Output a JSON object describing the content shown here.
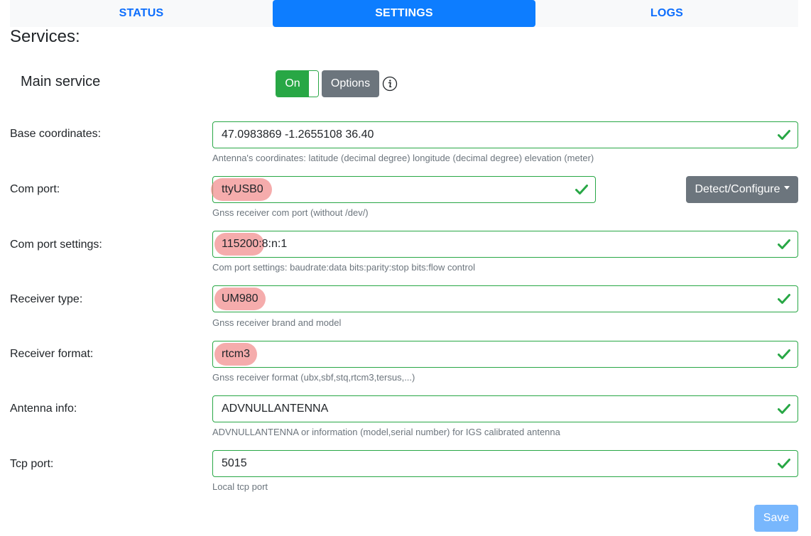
{
  "tabs": [
    {
      "label": "STATUS",
      "active": false
    },
    {
      "label": "SETTINGS",
      "active": true
    },
    {
      "label": "LOGS",
      "active": false
    }
  ],
  "section_title": "Services:",
  "main_service": {
    "label": "Main service",
    "toggle_label": "On",
    "toggle_state": true,
    "options_label": "Options",
    "info_icon": "info-circle-icon"
  },
  "fields": {
    "base_coordinates": {
      "label": "Base coordinates:",
      "value": "47.0983869 -1.2655108 36.40",
      "help": "Antenna's coordinates: latitude (decimal degree) longitude (decimal degree) elevation (meter)"
    },
    "com_port": {
      "label": "Com port:",
      "value": "ttyUSB0",
      "help": "Gnss receiver com port (without /dev/)"
    },
    "com_port_settings": {
      "label": "Com port settings:",
      "value": "115200:8:n:1",
      "help": "Com port settings: baudrate:data bits:parity:stop bits:flow control"
    },
    "receiver_type": {
      "label": "Receiver type:",
      "value": "UM980",
      "help": "Gnss receiver brand and model"
    },
    "receiver_format": {
      "label": "Receiver format:",
      "value": "rtcm3",
      "help": "Gnss receiver format (ubx,sbf,stq,rtcm3,tersus,...)"
    },
    "antenna_info": {
      "label": "Antenna info:",
      "value": "ADVNULLANTENNA",
      "help": "ADVNULLANTENNA or information (model,serial number) for IGS calibrated antenna"
    },
    "tcp_port": {
      "label": "Tcp port:",
      "value": "5015",
      "help": "Local tcp port"
    }
  },
  "detect_button_label": "Detect/Configure",
  "save_label": "Save",
  "colors": {
    "primary": "#0d7dff",
    "success": "#28a745",
    "secondary": "#6c757d",
    "highlight": "#f08080",
    "save_disabled": "#78b7fd"
  },
  "icons": {
    "valid": "check-icon",
    "dropdown": "caret-down-icon",
    "info": "info-circle-icon"
  }
}
